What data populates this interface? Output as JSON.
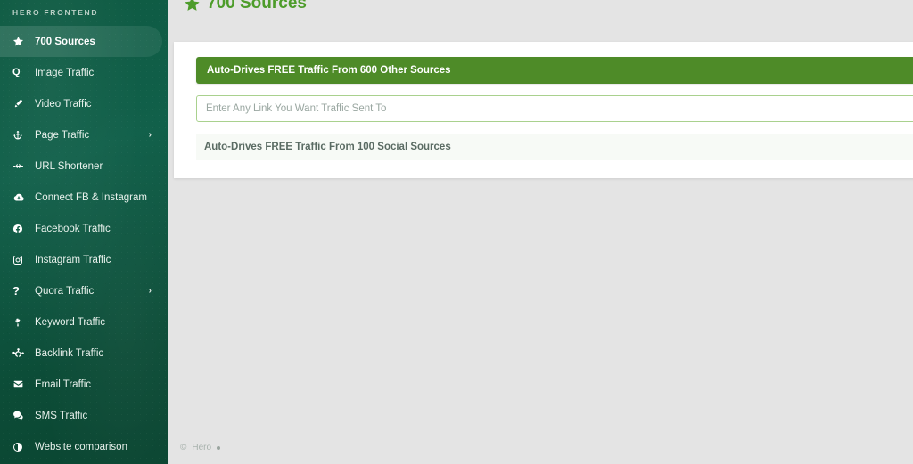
{
  "sidebar": {
    "brand": "HERO FRONTEND",
    "items": [
      {
        "label": "700 Sources",
        "icon": "star-icon",
        "active": true,
        "chevron": false
      },
      {
        "label": "Image Traffic",
        "icon": "letter-q-icon",
        "active": false,
        "chevron": false
      },
      {
        "label": "Video Traffic",
        "icon": "paintbrush-icon",
        "active": false,
        "chevron": false
      },
      {
        "label": "Page Traffic",
        "icon": "anchor-icon",
        "active": false,
        "chevron": true
      },
      {
        "label": "URL Shortener",
        "icon": "link-shorten-icon",
        "active": false,
        "chevron": false
      },
      {
        "label": "Connect FB & Instagram",
        "icon": "cloud-icon",
        "active": false,
        "chevron": false
      },
      {
        "label": "Facebook Traffic",
        "icon": "facebook-icon",
        "active": false,
        "chevron": false
      },
      {
        "label": "Instagram Traffic",
        "icon": "instagram-icon",
        "active": false,
        "chevron": false
      },
      {
        "label": "Quora Traffic",
        "icon": "question-mark-icon",
        "active": false,
        "chevron": true
      },
      {
        "label": "Keyword Traffic",
        "icon": "asterisk-icon",
        "active": false,
        "chevron": false
      },
      {
        "label": "Backlink Traffic",
        "icon": "network-nodes-icon",
        "active": false,
        "chevron": false
      },
      {
        "label": "Email Traffic",
        "icon": "envelope-icon",
        "active": false,
        "chevron": false
      },
      {
        "label": "SMS Traffic",
        "icon": "chat-bubbles-icon",
        "active": false,
        "chevron": false
      },
      {
        "label": "Website comparison",
        "icon": "half-circle-icon",
        "active": false,
        "chevron": false
      }
    ],
    "chevron_glyph": "›"
  },
  "main": {
    "page_title": "700 Sources",
    "banner_text": "Auto-Drives FREE Traffic From 600 Other Sources",
    "link_input_value": "",
    "link_input_placeholder": "Enter Any Link You Want Traffic Sent To",
    "sub_heading": "Auto-Drives FREE Traffic From 100 Social Sources"
  },
  "footer": {
    "copyright_symbol": "©",
    "text": "Hero"
  },
  "colors": {
    "sidebar_green_dark": "#0a4531",
    "sidebar_green_light": "#11604a",
    "accent_green": "#4d9c2a",
    "banner_green": "#4e8b28",
    "input_border_green": "#a9d18e",
    "page_background": "#e4e4e4",
    "card_background": "#ffffff",
    "subrow_background": "#f7faf6"
  }
}
